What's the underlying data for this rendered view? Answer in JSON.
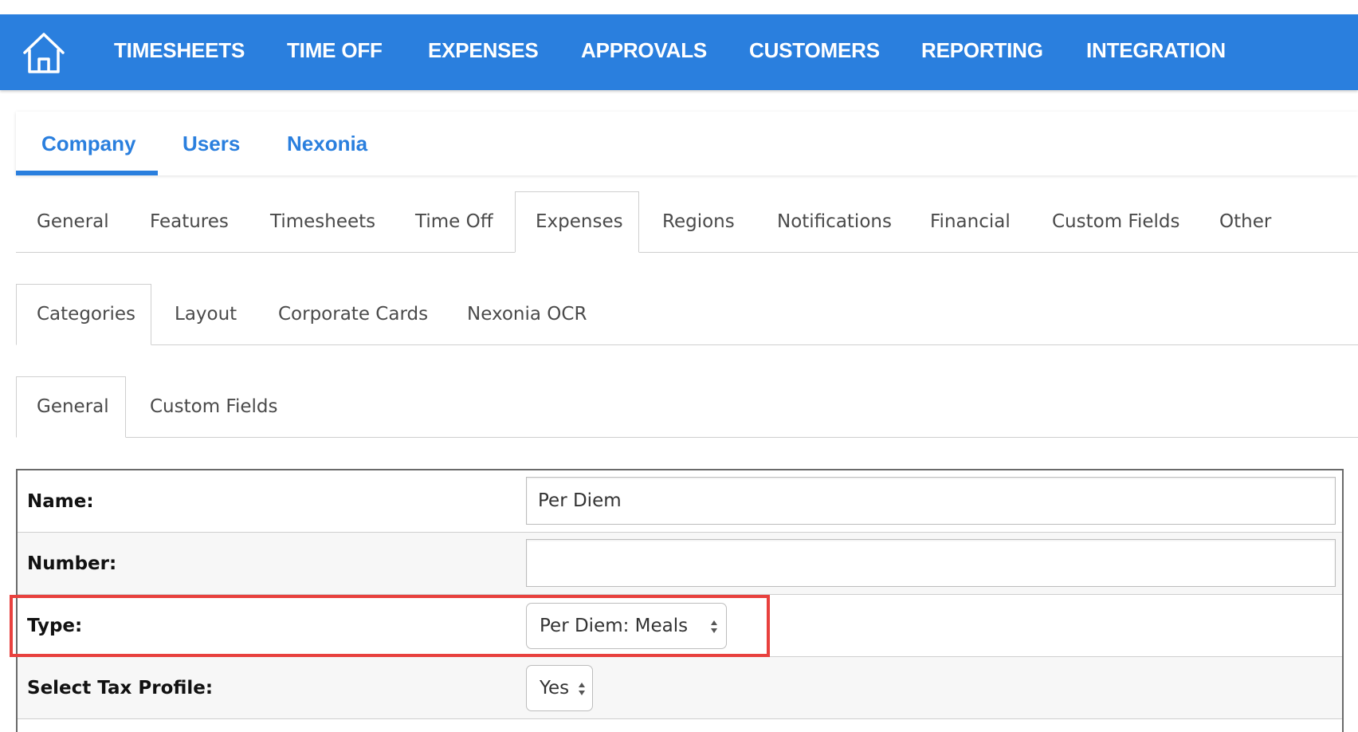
{
  "topnav": {
    "items": [
      "TIMESHEETS",
      "TIME OFF",
      "EXPENSES",
      "APPROVALS",
      "CUSTOMERS",
      "REPORTING",
      "INTEGRATION"
    ],
    "background": "#2a7fde"
  },
  "main_tabs": [
    "Company",
    "Users",
    "Nexonia"
  ],
  "settings_tabs": [
    "General",
    "Features",
    "Timesheets",
    "Time Off",
    "Expenses",
    "Regions",
    "Notifications",
    "Financial",
    "Custom Fields",
    "Other"
  ],
  "expense_tabs": [
    "Categories",
    "Layout",
    "Corporate Cards",
    "Nexonia OCR"
  ],
  "category_tabs": [
    "General",
    "Custom Fields"
  ],
  "form": {
    "name_label": "Name:",
    "name_value": "Per Diem",
    "number_label": "Number:",
    "number_value": "",
    "type_label": "Type:",
    "type_value": "Per Diem: Meals",
    "tax_label": "Select Tax Profile:",
    "tax_value": "Yes"
  },
  "highlight_color": "#e8413e"
}
